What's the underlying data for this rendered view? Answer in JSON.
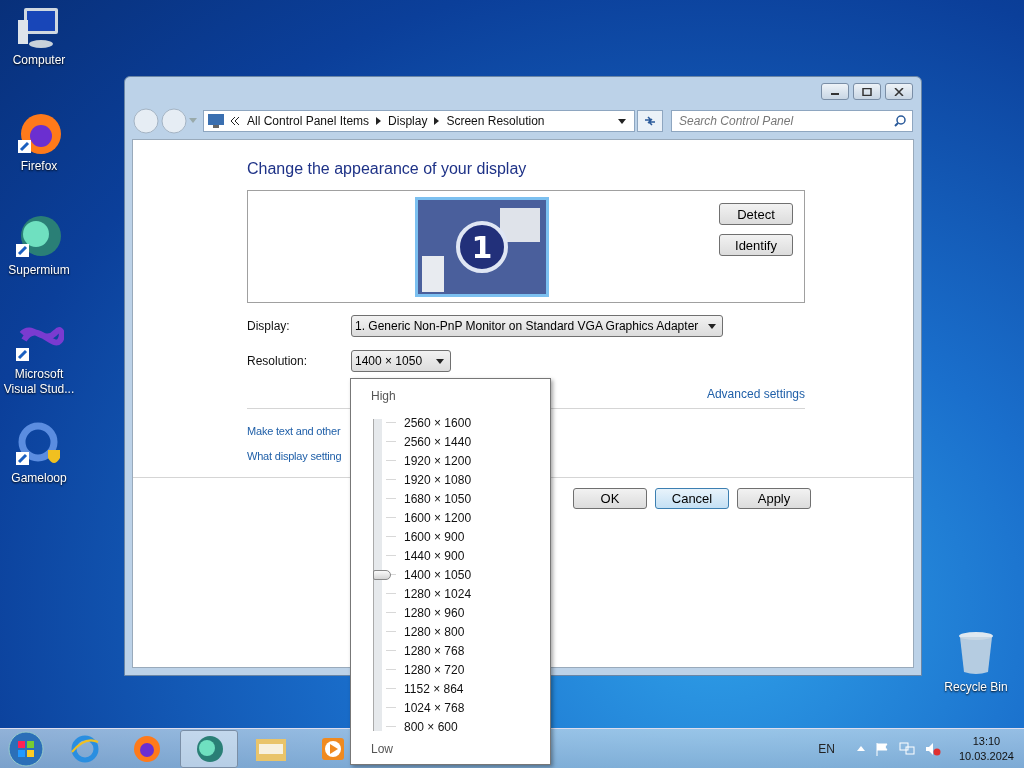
{
  "desktop_icons": [
    {
      "label": "Computer",
      "kind": "computer"
    },
    {
      "label": "Firefox",
      "kind": "firefox"
    },
    {
      "label": "Supermium",
      "kind": "supermium"
    },
    {
      "label": "Microsoft Visual Stud...",
      "kind": "vs"
    },
    {
      "label": "Gameloop",
      "kind": "gameloop"
    }
  ],
  "recycle_bin": {
    "label": "Recycle Bin"
  },
  "window": {
    "address": {
      "parts": [
        "All Control Panel Items",
        "Display",
        "Screen Resolution"
      ]
    },
    "search": {
      "placeholder": "Search Control Panel"
    },
    "heading": "Change the appearance of your display",
    "monitor": {
      "number": "1"
    },
    "side_buttons": [
      "Detect",
      "Identify"
    ],
    "display": {
      "label": "Display:",
      "value": "1. Generic Non-PnP Monitor on Standard VGA Graphics Adapter"
    },
    "resolution": {
      "label": "Resolution:",
      "value": "1400 × 1050"
    },
    "advanced_link": "Advanced settings",
    "links": [
      "Make text and other",
      "What display setting"
    ],
    "buttons": [
      {
        "label": "OK",
        "default": false
      },
      {
        "label": "Cancel",
        "default": true
      },
      {
        "label": "Apply",
        "default": false
      }
    ]
  },
  "resolution_menu": {
    "high_label": "High",
    "low_label": "Low",
    "level": 0.5,
    "options": [
      "2560 × 1600",
      "2560 × 1440",
      "1920 × 1200",
      "1920 × 1080",
      "1680 × 1050",
      "1600 × 1200",
      "1600 × 900",
      "1440 × 900",
      "1400 × 1050",
      "1280 × 1024",
      "1280 × 960",
      "1280 × 800",
      "1280 × 768",
      "1280 × 720",
      "1152 × 864",
      "1024 × 768",
      "800 × 600"
    ]
  },
  "taskbar": {
    "items": [
      {
        "kind": "ie",
        "selected": false
      },
      {
        "kind": "firefox",
        "selected": false
      },
      {
        "kind": "supermium",
        "selected": true
      },
      {
        "kind": "explorer",
        "selected": false
      },
      {
        "kind": "media",
        "selected": false
      }
    ],
    "language": "EN",
    "time": "13:10",
    "date": "10.03.2024"
  }
}
